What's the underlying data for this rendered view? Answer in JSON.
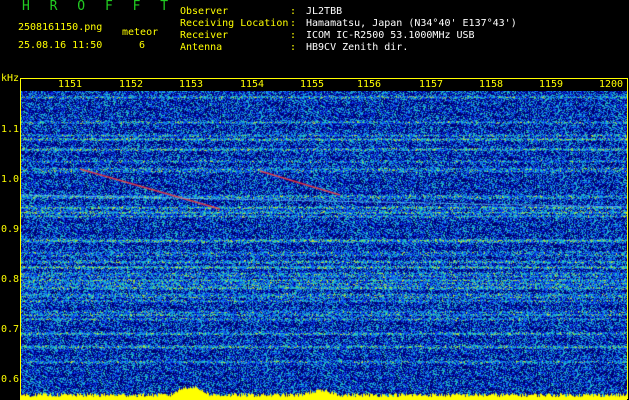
{
  "header": {
    "app_title": "H R O F F T",
    "filename": "2508161150.png",
    "datetime": "25.08.16 11:50",
    "meteor_label": "meteor",
    "meteor_count": "6",
    "fields": [
      {
        "label": "Observer",
        "sep": ":",
        "value": "JL2TBB"
      },
      {
        "label": "Receiving Location",
        "sep": ":",
        "value": "Hamamatsu, Japan (N34°40' E137°43')"
      },
      {
        "label": "Receiver",
        "sep": ":",
        "value": "ICOM IC-R2500 53.1000MHz USB"
      },
      {
        "label": "Antenna",
        "sep": ":",
        "value": "HB9CV Zenith dir."
      }
    ]
  },
  "time_axis": [
    "1151",
    "1152",
    "1153",
    "1154",
    "1155",
    "1156",
    "1157",
    "1158",
    "1159",
    "1200"
  ],
  "freq_axis": {
    "unit": "kHz",
    "labels": [
      "1.1",
      "1.0",
      "0.9",
      "0.8",
      "0.7",
      "0.6"
    ]
  },
  "colors": {
    "background": "#000000",
    "label_yellow": "#ffff00",
    "title_green": "#22cc22",
    "noise_base": "#0a2ad0",
    "echo_red": "#ff3030"
  }
}
